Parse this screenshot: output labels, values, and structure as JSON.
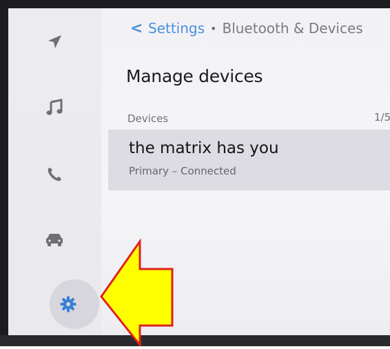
{
  "breadcrumb": {
    "back_symbol": "<",
    "parent": "Settings",
    "separator": "•",
    "current": "Bluetooth & Devices"
  },
  "page": {
    "title": "Manage devices"
  },
  "devices_section": {
    "header": "Devices",
    "count": "1/5"
  },
  "device": {
    "name": "the matrix has you",
    "status": "Primary – Connected"
  },
  "sidebar": {
    "items": [
      {
        "icon": "navigation-arrow-icon",
        "label": "Navigation"
      },
      {
        "icon": "music-note-icon",
        "label": "Media"
      },
      {
        "icon": "phone-icon",
        "label": "Phone"
      },
      {
        "icon": "car-icon",
        "label": "Vehicle"
      },
      {
        "icon": "gear-icon",
        "label": "Settings",
        "active": true
      }
    ]
  },
  "colors": {
    "accent": "#4a8fe0",
    "callout_fill": "#ffff00",
    "callout_stroke": "#e02020",
    "row_selected": "#dcdce2"
  },
  "annotation": {
    "type": "callout-arrow",
    "points_to": "gear-icon"
  }
}
